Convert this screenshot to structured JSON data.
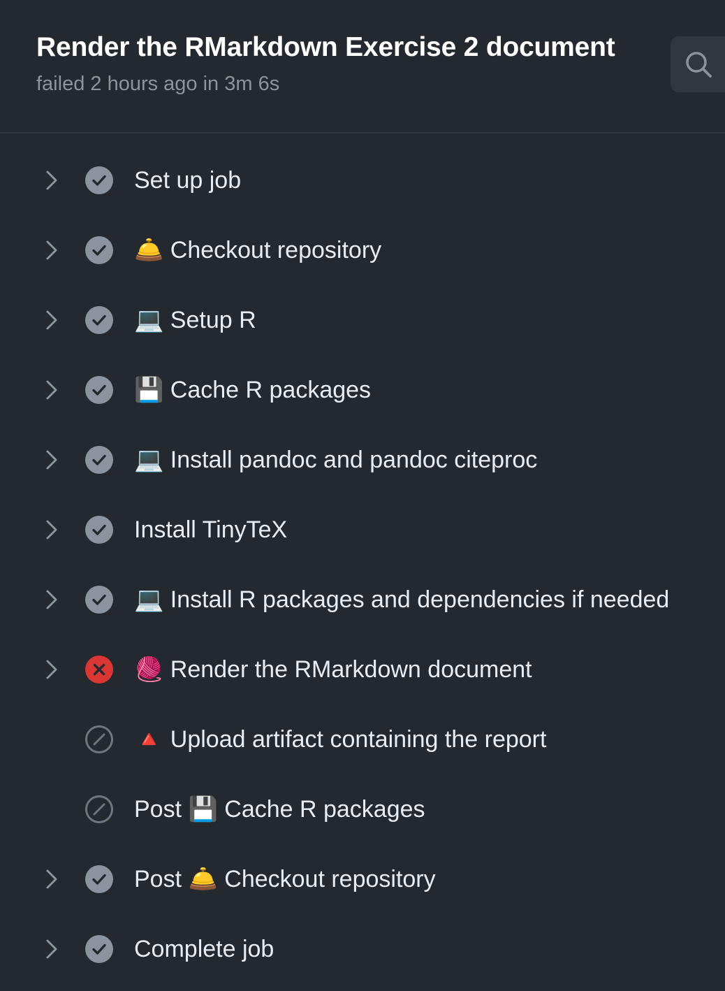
{
  "header": {
    "title": "Render the RMarkdown Exercise 2 document",
    "subtitle": "failed 2 hours ago in 3m 6s",
    "search_icon": "search-icon"
  },
  "colors": {
    "background": "#24292f",
    "success": "#8b949e",
    "failure": "#da3633",
    "skipped": "#6e7681"
  },
  "steps": [
    {
      "label": "Set up job",
      "status": "success",
      "expandable": true
    },
    {
      "label": "🛎️ Checkout repository",
      "status": "success",
      "expandable": true
    },
    {
      "label": "💻 Setup R",
      "status": "success",
      "expandable": true
    },
    {
      "label": "💾 Cache R packages",
      "status": "success",
      "expandable": true
    },
    {
      "label": "💻 Install pandoc and pandoc citeproc",
      "status": "success",
      "expandable": true
    },
    {
      "label": "Install TinyTeX",
      "status": "success",
      "expandable": true
    },
    {
      "label": "💻 Install R packages and dependencies if needed",
      "status": "success",
      "expandable": true
    },
    {
      "label": "🧶 Render the RMarkdown document",
      "status": "failure",
      "expandable": true
    },
    {
      "label": "🔺 Upload artifact containing the report",
      "status": "skipped",
      "expandable": false
    },
    {
      "label": "Post 💾 Cache R packages",
      "status": "skipped",
      "expandable": false
    },
    {
      "label": "Post 🛎️ Checkout repository",
      "status": "success",
      "expandable": true
    },
    {
      "label": "Complete job",
      "status": "success",
      "expandable": true
    }
  ]
}
